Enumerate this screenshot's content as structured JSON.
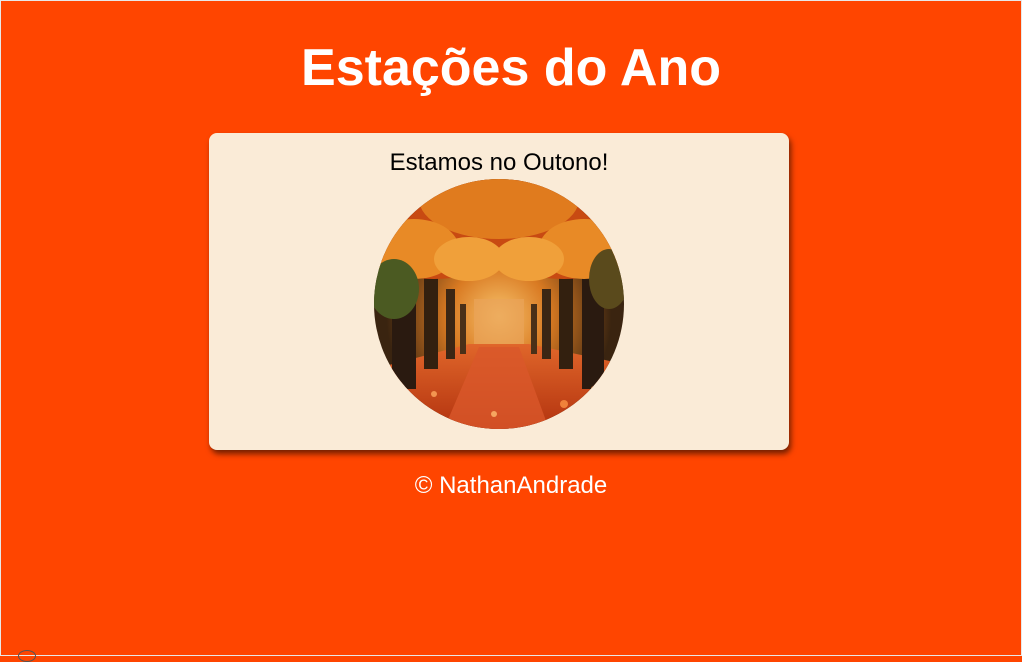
{
  "page": {
    "title": "Estações do Ano",
    "background_color": "#ff4500"
  },
  "card": {
    "message": "Estamos no Outono!",
    "background_color": "#faebd7",
    "image_icon": "autumn-forest-path-photo"
  },
  "footer": {
    "text": "© NathanAndrade"
  }
}
